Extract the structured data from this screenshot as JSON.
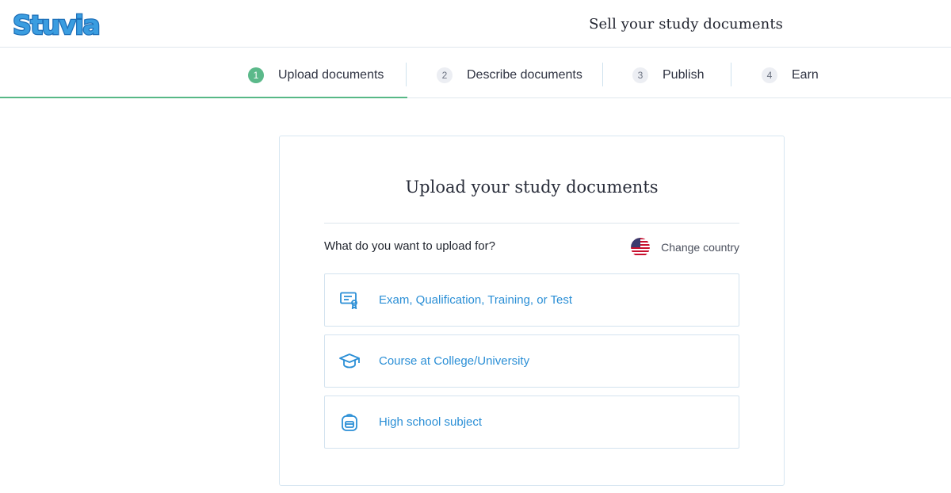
{
  "header": {
    "logo_text": "Stuvia",
    "title": "Sell your study documents"
  },
  "steps": [
    {
      "number": "1",
      "label": "Upload documents",
      "active": true
    },
    {
      "number": "2",
      "label": "Describe documents",
      "active": false
    },
    {
      "number": "3",
      "label": "Publish",
      "active": false
    },
    {
      "number": "4",
      "label": "Earn",
      "active": false
    }
  ],
  "card": {
    "title": "Upload your study documents",
    "question": "What do you want to upload for?",
    "change_country": "Change country",
    "options": [
      {
        "label": "Exam, Qualification, Training, or Test",
        "icon": "certificate-icon"
      },
      {
        "label": "Course at College/University",
        "icon": "graduation-cap-icon"
      },
      {
        "label": "High school subject",
        "icon": "backpack-icon"
      }
    ]
  },
  "colors": {
    "brand_blue": "#2b8fd6",
    "active_green": "#5bb98a",
    "border": "#d3e3ef"
  }
}
